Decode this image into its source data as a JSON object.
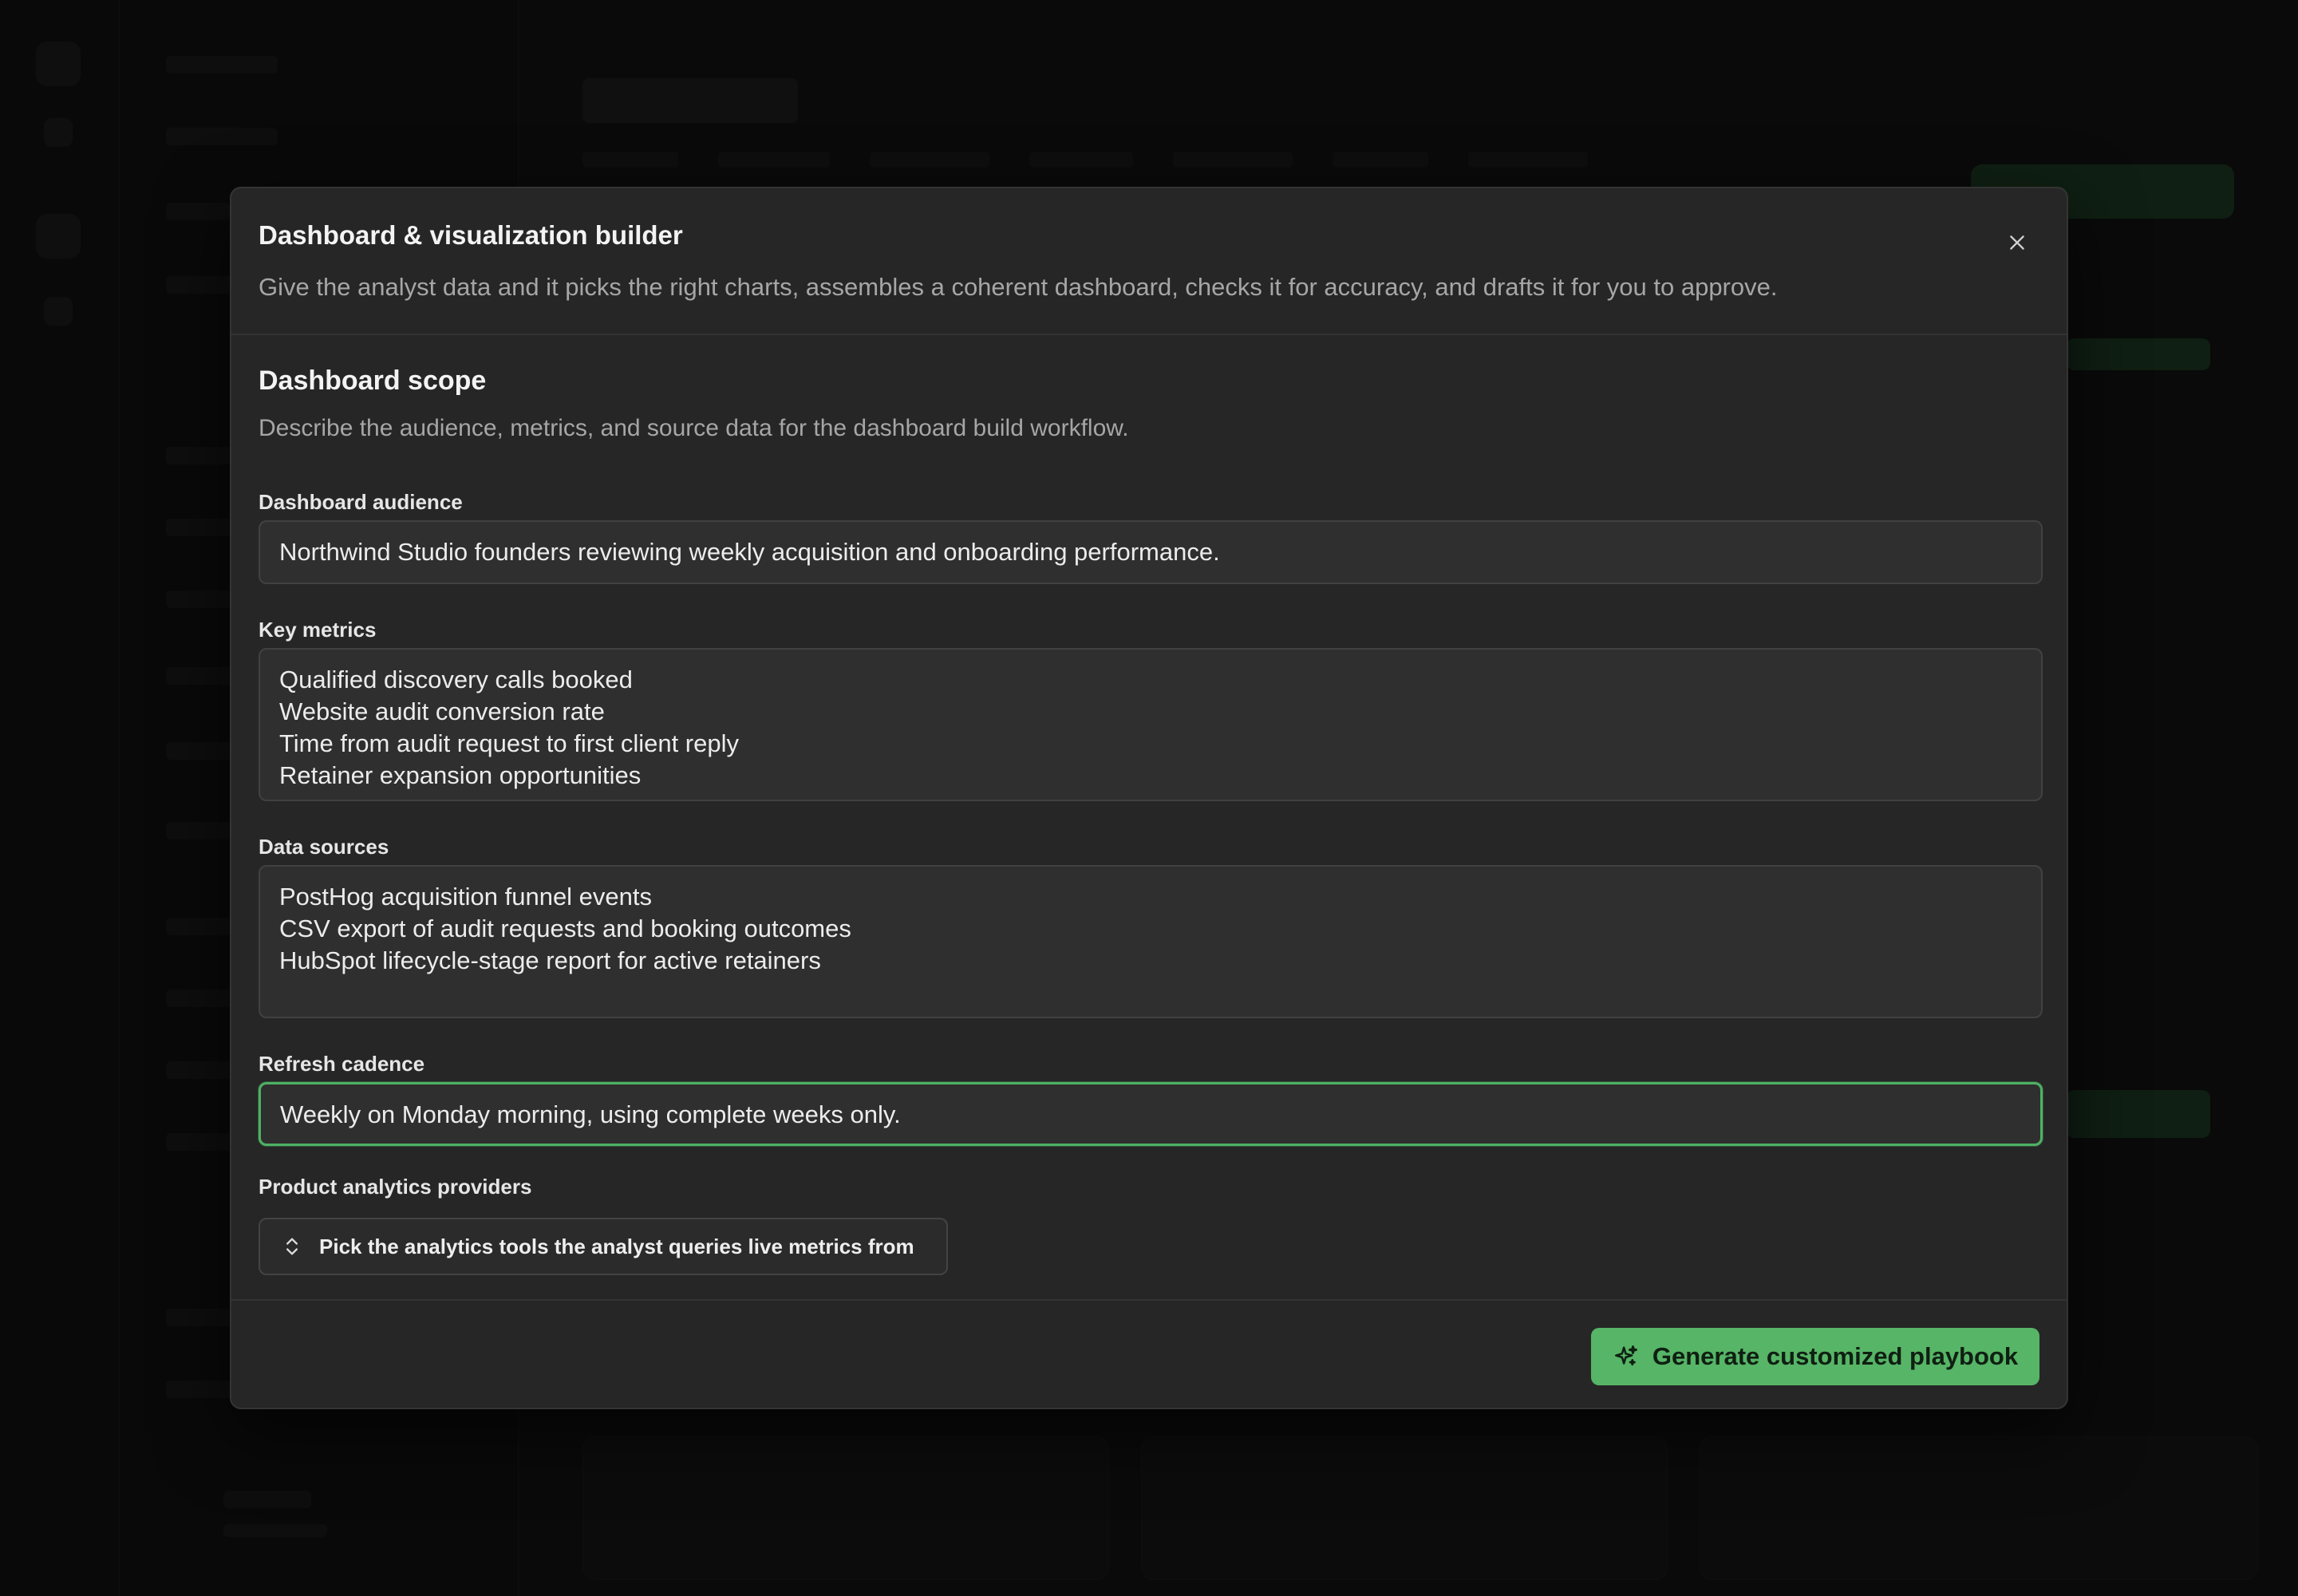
{
  "modal": {
    "title": "Dashboard & visualization builder",
    "description": "Give the analyst data and it picks the right charts, assembles a coherent dashboard, checks it for accuracy, and drafts it for you to approve."
  },
  "section": {
    "title": "Dashboard scope",
    "description": "Describe the audience, metrics, and source data for the dashboard build workflow."
  },
  "fields": {
    "audience": {
      "label": "Dashboard audience",
      "value": "Northwind Studio founders reviewing weekly acquisition and onboarding performance."
    },
    "metrics": {
      "label": "Key metrics",
      "lines": [
        "Qualified discovery calls booked",
        "Website audit conversion rate",
        "Time from audit request to first client reply",
        "Retainer expansion opportunities"
      ]
    },
    "sources": {
      "label": "Data sources",
      "lines": [
        "PostHog acquisition funnel events",
        "CSV export of audit requests and booking outcomes",
        "HubSpot lifecycle-stage report for active retainers"
      ]
    },
    "cadence": {
      "label": "Refresh cadence",
      "value": "Weekly on Monday morning, using complete weeks only."
    },
    "providers": {
      "label": "Product analytics providers",
      "button_label": "Pick the analytics tools the analyst queries live metrics from"
    }
  },
  "footer": {
    "generate_label": "Generate customized playbook"
  },
  "colors": {
    "accent": "#56b566",
    "focus_ring": "#4fb164",
    "modal_bg": "#262626"
  },
  "icons": {
    "close": "close-icon",
    "select": "chevron-up-down-icon",
    "generate": "sparkles-icon"
  }
}
